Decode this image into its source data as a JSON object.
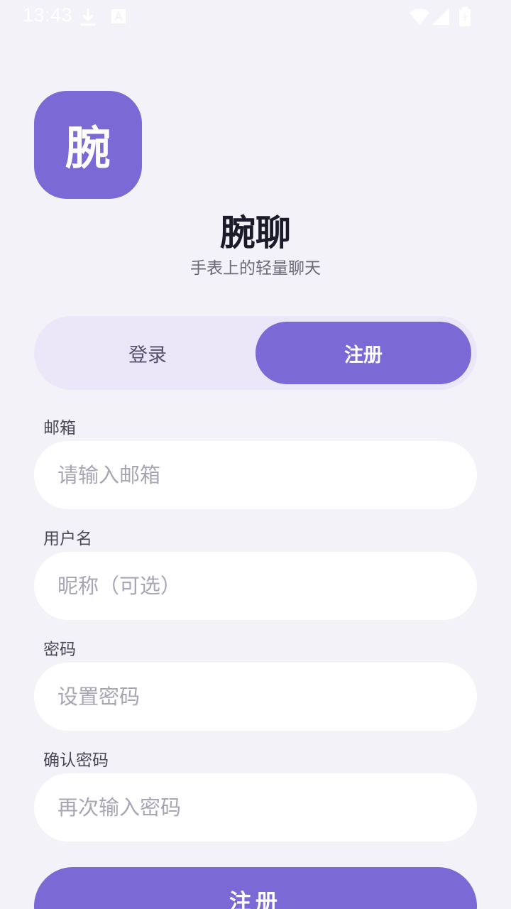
{
  "status_bar": {
    "time": "13:43",
    "icons": [
      "download-icon",
      "text-a-icon",
      "wifi-icon",
      "signal-icon",
      "battery-charging-icon"
    ]
  },
  "app": {
    "logo_char": "腕",
    "name": "腕聊",
    "tagline": "手表上的轻量聊天"
  },
  "tabs": {
    "login_label": "登录",
    "register_label": "注册",
    "active": "register"
  },
  "form": {
    "email": {
      "label": "邮箱",
      "placeholder": "请输入邮箱",
      "value": ""
    },
    "username": {
      "label": "用户名",
      "placeholder": "昵称（可选）",
      "value": ""
    },
    "password": {
      "label": "密码",
      "placeholder": "设置密码",
      "value": ""
    },
    "confirm_password": {
      "label": "确认密码",
      "placeholder": "再次输入密码",
      "value": ""
    },
    "submit_label": "注册"
  },
  "colors": {
    "accent": "#7b6ad6",
    "background": "#f4f2f9",
    "tab_track": "#ebe7f8",
    "input_bg": "#ffffff",
    "placeholder": "#a8a5b5"
  }
}
